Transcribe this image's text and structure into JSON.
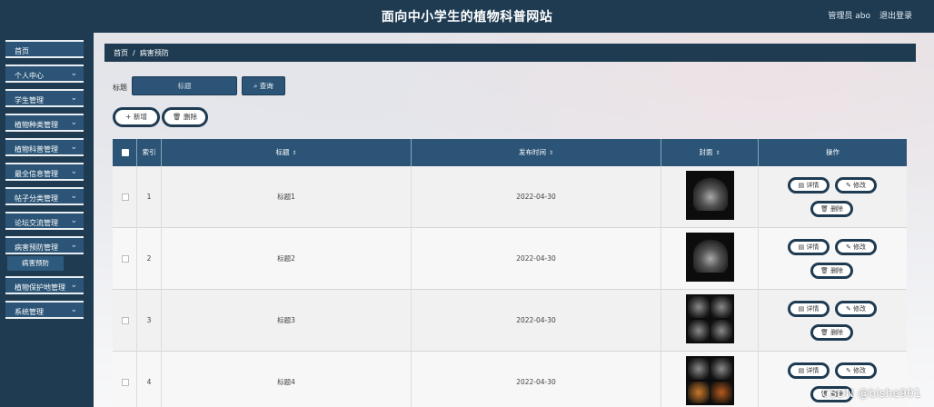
{
  "header": {
    "title": "面向中小学生的植物科普网站",
    "user": "管理员 abo",
    "logout": "退出登录"
  },
  "sidebar": {
    "items": [
      {
        "label": "首页",
        "chevron": false
      },
      {
        "label": "个人中心",
        "chevron": true
      },
      {
        "label": "学生管理",
        "chevron": true
      },
      {
        "label": "植物种类管理",
        "chevron": true
      },
      {
        "label": "植物科普管理",
        "chevron": true
      },
      {
        "label": "最全信息管理",
        "chevron": true
      },
      {
        "label": "帖子分类管理",
        "chevron": true
      },
      {
        "label": "论坛交流管理",
        "chevron": true
      },
      {
        "label": "病害预防管理",
        "chevron": true
      },
      {
        "label": "植物保护地管理",
        "chevron": true
      },
      {
        "label": "系统管理",
        "chevron": true
      }
    ],
    "submenu": {
      "label": "病害预防"
    }
  },
  "breadcrumb": {
    "home": "首页",
    "sep": "/",
    "current": "病害预防"
  },
  "search": {
    "label": "标题",
    "placeholder": "标题",
    "button": "查询"
  },
  "actions": {
    "add": "新增",
    "delete": "删除"
  },
  "table": {
    "columns": [
      "索引",
      "标题",
      "发布时间",
      "封面",
      "操作"
    ],
    "rows": [
      {
        "index": "1",
        "title": "标题1",
        "date": "2022-04-30"
      },
      {
        "index": "2",
        "title": "标题2",
        "date": "2022-04-30"
      },
      {
        "index": "3",
        "title": "标题3",
        "date": "2022-04-30"
      },
      {
        "index": "4",
        "title": "标题4",
        "date": "2022-04-30"
      }
    ],
    "ops": {
      "detail": "详情",
      "edit": "修改",
      "delete": "删除"
    }
  },
  "watermark": "CSDN @bishe901",
  "colors": {
    "navy": "#1e3b52",
    "steel": "#2b5476"
  }
}
